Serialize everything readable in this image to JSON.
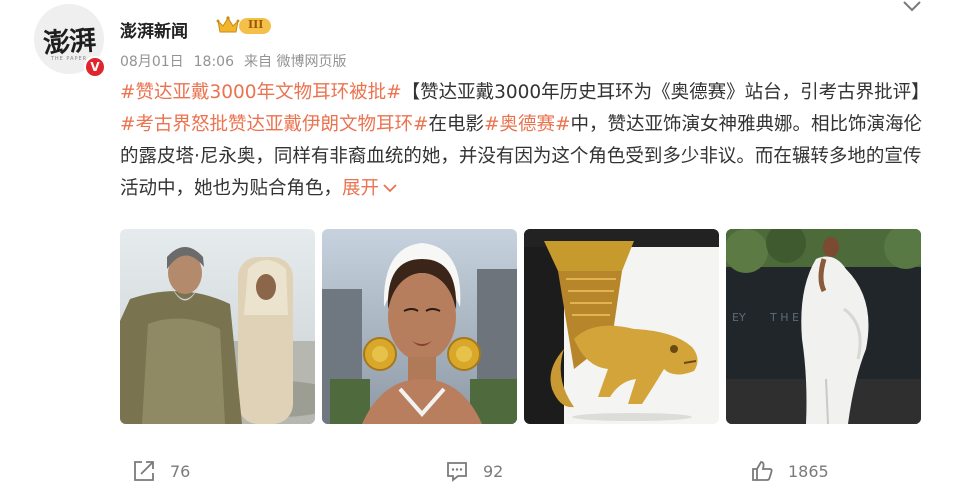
{
  "post": {
    "author": {
      "name": "澎湃新闻",
      "avatar_text": "澎湃",
      "avatar_subtext": "THE PAPER",
      "verified_mark": "V",
      "level": "III"
    },
    "meta": {
      "date": "08月01日",
      "time": "18:06",
      "source": "来自 微博网页版"
    },
    "content": {
      "tag1": "#赞达亚戴3000年文物耳环被批#",
      "text1": "【赞达亚戴3000年历史耳环为《奥德赛》站台，引考古界批评】",
      "tag2": "#考古界怒批赞达亚戴伊朗文物耳环#",
      "text2": "在电影",
      "tag3": "#奥德赛#",
      "text3": "中，赞达亚饰演女神雅典娜。相比饰演海伦的露皮塔·尼永奥，同样有非裔血统的她，并没有因为这个角色受到多少非议。而在辗转多地的宣传活动中，她也为贴合角色，",
      "expand": "展开"
    },
    "images": [
      {
        "icon": "movie-still-photo"
      },
      {
        "icon": "portrait-photo"
      },
      {
        "icon": "golden-rhyton-photo"
      },
      {
        "icon": "red-carpet-photo",
        "poster_text_1": "EY",
        "poster_text_2": "T H E   O D Y S S"
      }
    ],
    "actions": {
      "reposts": "76",
      "comments": "92",
      "likes": "1865"
    }
  },
  "colors": {
    "accent": "#eb7350",
    "meta_gray": "#939393",
    "verified_red": "#e0262c",
    "badge_gold": "#f5c04a"
  }
}
